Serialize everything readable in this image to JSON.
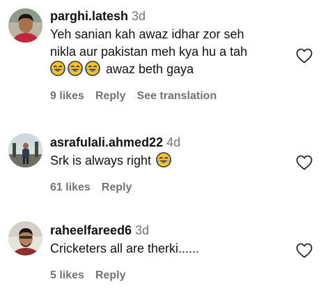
{
  "comments": [
    {
      "username": "parghi.latesh",
      "age": "3d",
      "line1": "Yeh sanian kah awaz idhar zor seh",
      "line2": "nikla aur pakistan meh kya hu a tah",
      "line3_after_emoji": "awaz beth gaya",
      "emoji_icons": [
        "laughing-tears-emoji",
        "laughing-tears-emoji",
        "laughing-tears-emoji"
      ],
      "likes": "9 likes",
      "reply": "Reply",
      "translate": "See translation"
    },
    {
      "username": "asrafulali.ahmed22",
      "age": "4d",
      "line1": "Srk is always right",
      "emoji_icons": [
        "laughing-tears-emoji"
      ],
      "likes": "61 likes",
      "reply": "Reply"
    },
    {
      "username": "raheelfareed6",
      "age": "3d",
      "line1": "Cricketers all are therki......",
      "likes": "5 likes",
      "reply": "Reply"
    }
  ],
  "icons": {
    "like": "heart-outline-icon"
  },
  "colors": {
    "muted": "#737373",
    "text": "#111111",
    "emoji": "#f5b800"
  }
}
